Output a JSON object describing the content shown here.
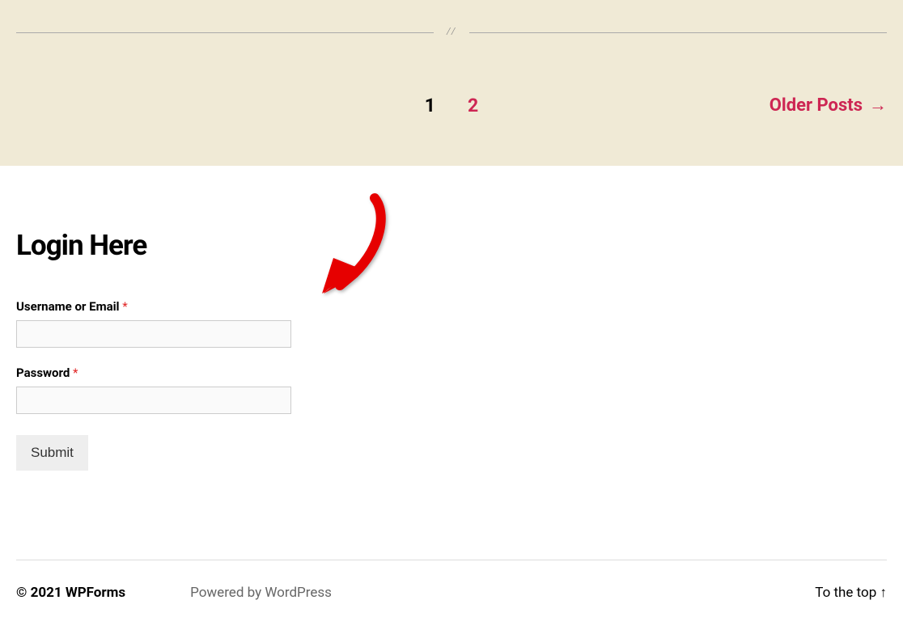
{
  "divider": {
    "text": "//"
  },
  "pagination": {
    "current": "1",
    "next": "2",
    "older_posts_label": "Older Posts"
  },
  "login": {
    "heading": "Login Here",
    "username_label": "Username or Email",
    "password_label": "Password",
    "required_mark": "*",
    "submit_label": "Submit"
  },
  "footer": {
    "copyright": "© 2021 WPForms",
    "powered": "Powered by WordPress",
    "to_top": "To the top ↑"
  }
}
